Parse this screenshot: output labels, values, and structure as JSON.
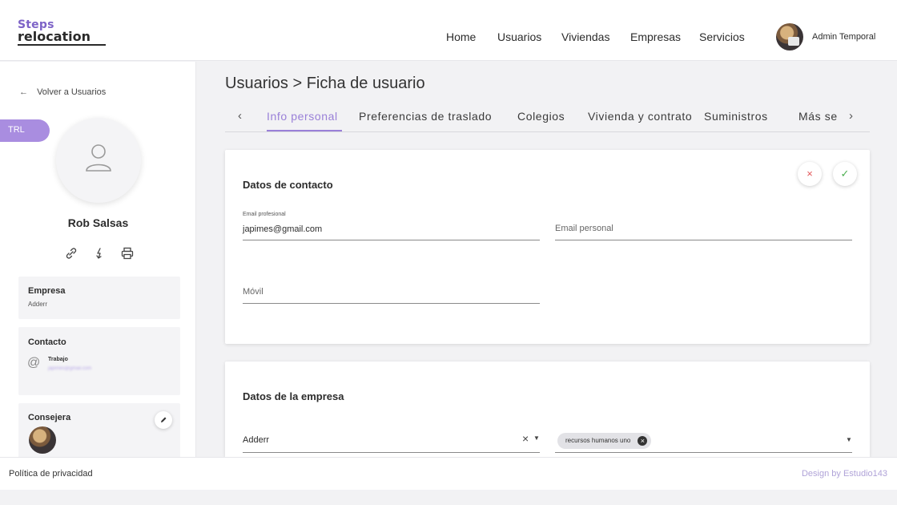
{
  "brand": {
    "line1": "Steps",
    "line2": "relocation"
  },
  "nav": {
    "items": [
      "Home",
      "Usuarios",
      "Viviendas",
      "Empresas",
      "Servicios"
    ],
    "user_name": "Admin Temporal",
    "avatar_icon": "user-photo"
  },
  "sidebar": {
    "back_label": "Volver a Usuarios",
    "badge": "TRL",
    "user_name": "Rob Salsas",
    "actions": [
      "link-icon",
      "download-icon",
      "print-icon"
    ],
    "empresa": {
      "title": "Empresa",
      "value": "Adderr"
    },
    "contacto": {
      "title": "Contacto",
      "label": "Trabajo",
      "value": "japimes@gmail.com"
    },
    "consejera": {
      "title": "Consejera"
    }
  },
  "main": {
    "breadcrumb": "Usuarios > Ficha de usuario",
    "tabs": [
      "Info personal",
      "Preferencias de traslado",
      "Colegios",
      "Vivienda y contrato",
      "Suministros",
      "Más se"
    ],
    "active_tab": "Info personal",
    "contact": {
      "title": "Datos de contacto",
      "email_profesional_label": "Email profesional",
      "email_profesional_value": "japimes@gmail.com",
      "email_personal_placeholder": "Email personal",
      "movil_placeholder": "Móvil"
    },
    "empresa": {
      "title": "Datos de la empresa",
      "company_value": "Adderr",
      "chip": "recursos humanos uno"
    }
  },
  "footer": {
    "left": "Política de privacidad",
    "right": "Design by Estudio143"
  },
  "colors": {
    "accent": "#9a80d8",
    "badge": "#a98de0",
    "cancel": "#e2575a",
    "confirm": "#4caf50"
  }
}
